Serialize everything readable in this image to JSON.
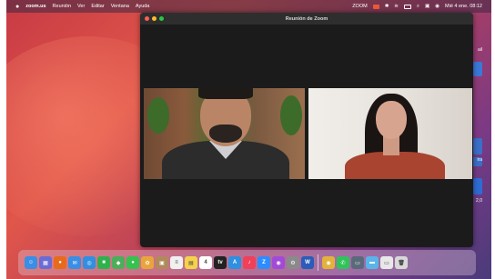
{
  "menubar": {
    "apple_icon": "apple-icon",
    "app_name": "zoom.us",
    "menus": [
      "Reunión",
      "Ver",
      "Editar",
      "Ventana",
      "Ayuda"
    ],
    "status_text": "ZOOM",
    "clock": "Mié 4 ene. 08:12"
  },
  "window": {
    "title": "Reunión de Zoom"
  },
  "participants": [
    {
      "kind": "video",
      "description_icon": "participant-video"
    },
    {
      "kind": "video",
      "description_icon": "participant-video"
    }
  ],
  "desktop_edge_labels": [
    "ail",
    "ira",
    "2,0"
  ],
  "dock": {
    "items": [
      {
        "name": "finder",
        "color": "#3a8ee6",
        "glyph": "☺"
      },
      {
        "name": "launchpad",
        "color": "#6b6bd6",
        "glyph": "▦"
      },
      {
        "name": "firefox",
        "color": "#e86a1c",
        "glyph": "●"
      },
      {
        "name": "mail",
        "color": "#3a8ee6",
        "glyph": "✉"
      },
      {
        "name": "safari",
        "color": "#2f8fe0",
        "glyph": "◎"
      },
      {
        "name": "facetime",
        "color": "#2fb24c",
        "glyph": "■"
      },
      {
        "name": "maps",
        "color": "#4cae5a",
        "glyph": "◆"
      },
      {
        "name": "messages",
        "color": "#35c24e",
        "glyph": "●"
      },
      {
        "name": "photos",
        "color": "#e9a53c",
        "glyph": "✿"
      },
      {
        "name": "contacts",
        "color": "#b08a5a",
        "glyph": "▣"
      },
      {
        "name": "reminders",
        "color": "#f0f0f0",
        "glyph": "≡"
      },
      {
        "name": "notes",
        "color": "#f5d24b",
        "glyph": "▤"
      },
      {
        "name": "calendar",
        "color": "#ffffff",
        "glyph": "4"
      },
      {
        "name": "tv",
        "color": "#222222",
        "glyph": "tv"
      },
      {
        "name": "app-store",
        "color": "#2f8fe0",
        "glyph": "A"
      },
      {
        "name": "music",
        "color": "#f0405a",
        "glyph": "♪"
      },
      {
        "name": "zoom",
        "color": "#2d8cff",
        "glyph": "Z"
      },
      {
        "name": "podcasts",
        "color": "#a24ad8",
        "glyph": "◉"
      },
      {
        "name": "settings",
        "color": "#8a8a8a",
        "glyph": "⚙"
      },
      {
        "name": "word",
        "color": "#2b5cb8",
        "glyph": "W"
      },
      {
        "name": "chrome",
        "color": "#e2b23c",
        "glyph": "◉"
      },
      {
        "name": "whatsapp",
        "color": "#2fc35a",
        "glyph": "✆"
      },
      {
        "name": "screenshot",
        "color": "#5a6a7a",
        "glyph": "▭"
      },
      {
        "name": "folder",
        "color": "#5ab4e8",
        "glyph": "▬"
      },
      {
        "name": "window",
        "color": "#e8e8e8",
        "glyph": "▭"
      },
      {
        "name": "trash",
        "color": "#d8d8d8",
        "glyph": "🗑"
      }
    ]
  }
}
